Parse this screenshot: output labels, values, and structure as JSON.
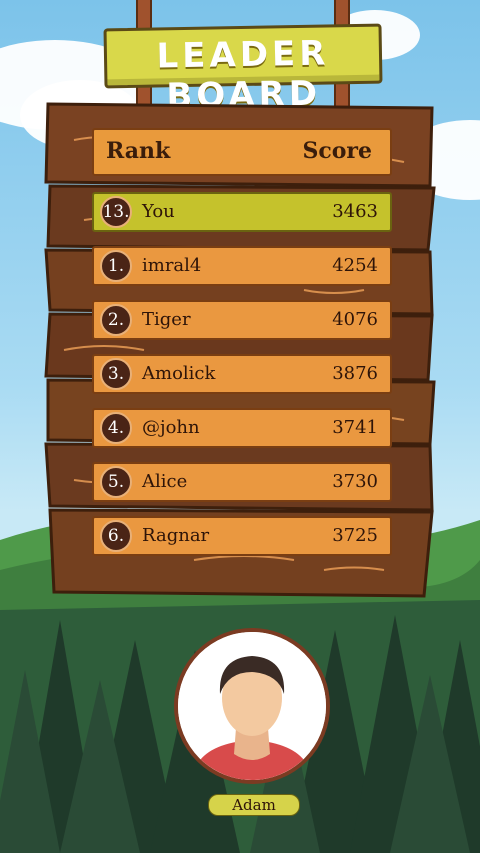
{
  "title": "LEADER BOARD",
  "header": {
    "rank_label": "Rank",
    "score_label": "Score"
  },
  "current_user_row": {
    "rank": "13.",
    "name": "You",
    "score": "3463"
  },
  "leaderboard": [
    {
      "rank": "1.",
      "name": "imral4",
      "score": "4254"
    },
    {
      "rank": "2.",
      "name": "Tiger",
      "score": "4076"
    },
    {
      "rank": "3.",
      "name": "Amolick",
      "score": "3876"
    },
    {
      "rank": "4.",
      "name": "@john",
      "score": "3741"
    },
    {
      "rank": "5.",
      "name": "Alice",
      "score": "3730"
    },
    {
      "rank": "6.",
      "name": "Ragnar",
      "score": "3725"
    }
  ],
  "profile": {
    "name": "Adam"
  },
  "colors": {
    "sky": "#a9dbf3",
    "wood_dark": "#6b3a1f",
    "row_orange": "#ea9840",
    "highlight_yellow": "#c5c22c",
    "title_sign": "#d9d84a",
    "forest": "#2f5a3c"
  },
  "icons": {
    "avatar": "person-avatar-icon"
  }
}
